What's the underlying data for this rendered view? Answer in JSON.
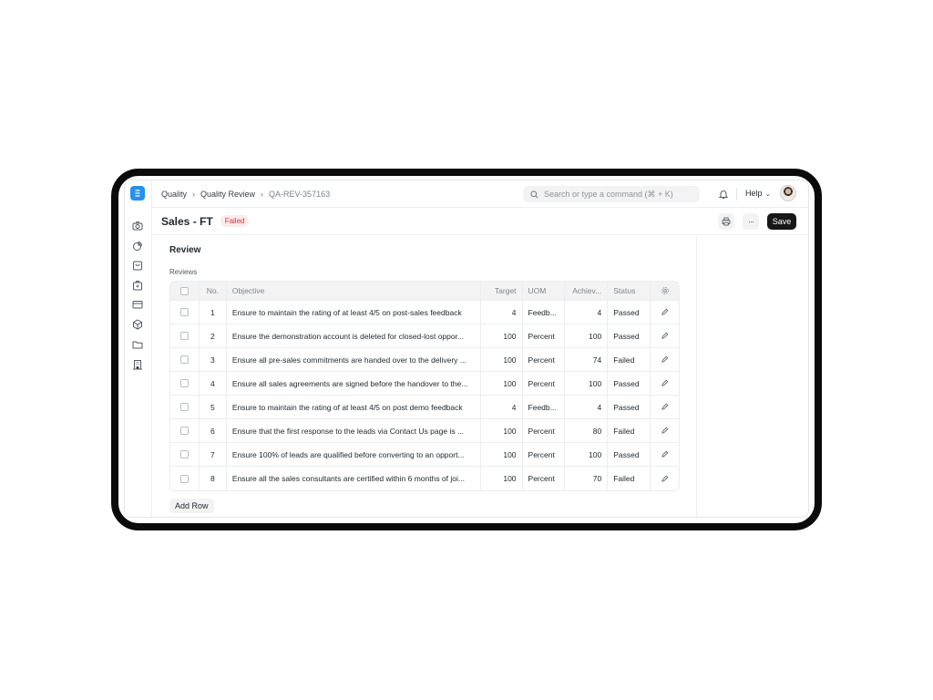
{
  "navbar": {
    "breadcrumbs": [
      "Quality",
      "Quality Review",
      "QA-REV-357163"
    ],
    "search_placeholder": "Search or type a command (⌘ + K)",
    "help_label": "Help"
  },
  "sidebar": {
    "logo_icon": "erp-logo",
    "icons": [
      "camera-icon",
      "pie-chart-icon",
      "shopping-bag-icon",
      "toolbox-icon",
      "credit-card-icon",
      "package-icon",
      "folder-icon",
      "building-icon"
    ]
  },
  "page": {
    "title": "Sales - FT",
    "status": "Failed",
    "save_label": "Save",
    "more_label": "···"
  },
  "form": {
    "section_title": "Review",
    "table_label": "Reviews",
    "columns": {
      "no": "No.",
      "objective": "Objective",
      "target": "Target",
      "uom": "UOM",
      "achieved": "Achiev...",
      "status": "Status"
    },
    "rows": [
      {
        "no": "1",
        "objective": "Ensure to maintain the rating of at least 4/5 on post-sales feedback",
        "target": "4",
        "uom": "Feedb...",
        "achieved": "4",
        "status": "Passed"
      },
      {
        "no": "2",
        "objective": "Ensure the demonstration account is deleted for closed-lost oppor...",
        "target": "100",
        "uom": "Percent",
        "achieved": "100",
        "status": "Passed"
      },
      {
        "no": "3",
        "objective": "Ensure all pre-sales commitments are handed over to the delivery ...",
        "target": "100",
        "uom": "Percent",
        "achieved": "74",
        "status": "Failed"
      },
      {
        "no": "4",
        "objective": "Ensure all sales agreements are signed before the handover to the...",
        "target": "100",
        "uom": "Percent",
        "achieved": "100",
        "status": "Passed"
      },
      {
        "no": "5",
        "objective": "Ensure to maintain the rating of at least 4/5 on post demo feedback",
        "target": "4",
        "uom": "Feedb...",
        "achieved": "4",
        "status": "Passed"
      },
      {
        "no": "6",
        "objective": "Ensure that the first response to the leads via Contact Us page is ...",
        "target": "100",
        "uom": "Percent",
        "achieved": "80",
        "status": "Failed"
      },
      {
        "no": "7",
        "objective": "Ensure 100% of leads are qualified before converting to an opport...",
        "target": "100",
        "uom": "Percent",
        "achieved": "100",
        "status": "Passed"
      },
      {
        "no": "8",
        "objective": "Ensure all the sales consultants are certified within 6 months of joi...",
        "target": "100",
        "uom": "Percent",
        "achieved": "70",
        "status": "Failed"
      }
    ],
    "add_row_label": "Add Row"
  },
  "colors": {
    "brand": "#2490ef",
    "failed_text": "#e03636",
    "failed_bg": "#fdeaea",
    "save_bg": "#171717"
  }
}
